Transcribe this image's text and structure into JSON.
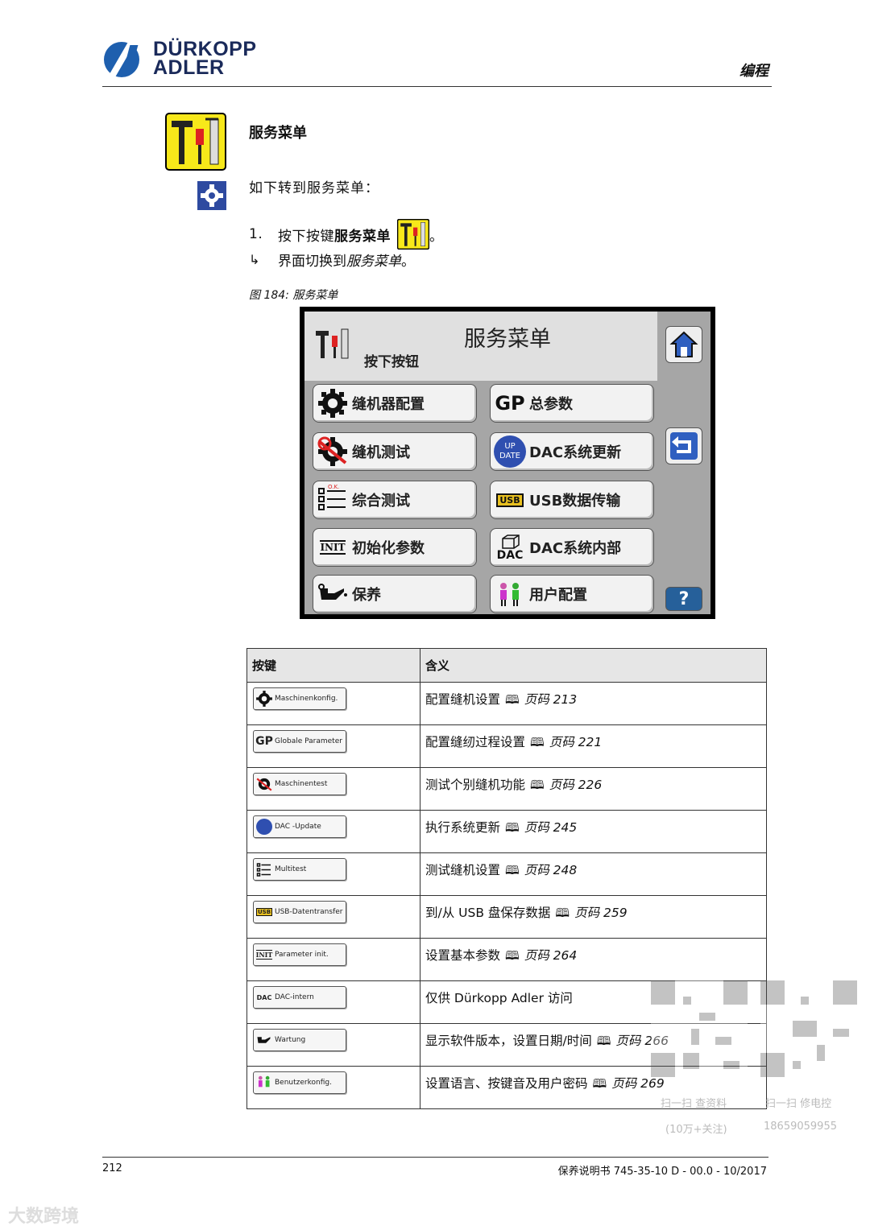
{
  "header": {
    "brand_line1": "DÜRKOPP",
    "brand_line2": "ADLER",
    "section": "编程"
  },
  "title": "服务菜单",
  "lead": "如下转到服务菜单：",
  "step": {
    "num": "1.",
    "text_a": "按下按键",
    "text_b": "服务菜单",
    "text_c": "。"
  },
  "result": {
    "text_a": "界面切换到",
    "text_b": "服务菜单",
    "text_c": "。"
  },
  "caption": "图 184: 服务菜单",
  "screen": {
    "title": "服务菜单",
    "hint": "按下按钮",
    "buttons": [
      {
        "label": "缝机器配置",
        "icon": "gear-icon"
      },
      {
        "label": "总参数",
        "icon": "gp-icon"
      },
      {
        "label": "缝机测试",
        "icon": "gear-test-icon"
      },
      {
        "label": "DAC系统更新",
        "icon": "update-icon"
      },
      {
        "label": "综合测试",
        "icon": "checklist-icon"
      },
      {
        "label": "USB数据传输",
        "icon": "usb-icon"
      },
      {
        "label": "初始化参数",
        "icon": "init-icon"
      },
      {
        "label": "DAC系统内部",
        "icon": "dac-icon"
      },
      {
        "label": "保养",
        "icon": "oil-can-icon"
      },
      {
        "label": "用户配置",
        "icon": "users-icon"
      }
    ],
    "gp_text": "GP",
    "init_text": "INIT",
    "usb_text": "USB",
    "dac_text": "DAC",
    "up_text": "UP",
    "date_text": "DATE",
    "help_text": "?"
  },
  "table": {
    "headers": [
      "按键",
      "含义"
    ],
    "rows": [
      {
        "key": "Maschinenkonfig.",
        "icon": "gear-icon",
        "meaning": "配置缝机设置",
        "page": "页码 213"
      },
      {
        "key": "Globale Parameter",
        "icon": "gp-icon",
        "meaning": "配置缝纫过程设置",
        "page": "页码 221"
      },
      {
        "key": "Maschinentest",
        "icon": "gear-test-icon",
        "meaning": "测试个别缝机功能",
        "page": "页码 226"
      },
      {
        "key": "DAC -Update",
        "icon": "update-icon",
        "meaning": "执行系统更新",
        "page": "页码 245"
      },
      {
        "key": "Multitest",
        "icon": "checklist-icon",
        "meaning": "测试缝机设置",
        "page": "页码 248"
      },
      {
        "key": "USB-Datentransfer",
        "icon": "usb-icon",
        "meaning": "到/从 USB 盘保存数据",
        "page": "页码 259"
      },
      {
        "key": "Parameter init.",
        "icon": "init-icon",
        "meaning": "设置基本参数",
        "page": "页码 264"
      },
      {
        "key": "DAC-intern",
        "icon": "dac-icon",
        "meaning": "仅供 Dürkopp Adler 访问",
        "page": ""
      },
      {
        "key": "Wartung",
        "icon": "oil-can-icon",
        "meaning": "显示软件版本，设置日期/时间",
        "page": "页码 266"
      },
      {
        "key": "Benutzerkonfig.",
        "icon": "users-icon",
        "meaning": "设置语言、按键音及用户密码",
        "page": "页码 269"
      }
    ]
  },
  "footer": {
    "page_number": "212",
    "doc": "保养说明书 745-35-10 D - 00.0 - 10/2017"
  },
  "watermark": {
    "left_label": "扫一扫 查资料",
    "left_sub": "(10万+关注)",
    "right_label": "扫一扫 修电控",
    "right_sub": "18659059955",
    "corner": "大数跨境"
  }
}
